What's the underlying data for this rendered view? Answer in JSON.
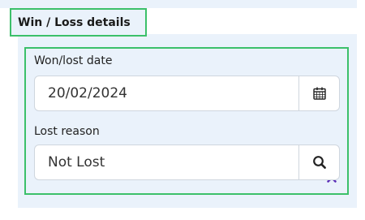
{
  "section": {
    "title": "Win / Loss details"
  },
  "won_lost_date": {
    "label": "Won/lost date",
    "value": "20/02/2024",
    "picker_icon": "calendar-icon"
  },
  "lost_reason": {
    "label": "Lost reason",
    "value": "Not Lost",
    "clear_icon": "close-icon",
    "search_icon": "search-icon"
  },
  "colors": {
    "highlight_border": "#3cc06a",
    "panel_background": "#eaf2fb",
    "clear_icon": "#5b2db8",
    "input_border": "#cfd6de"
  }
}
